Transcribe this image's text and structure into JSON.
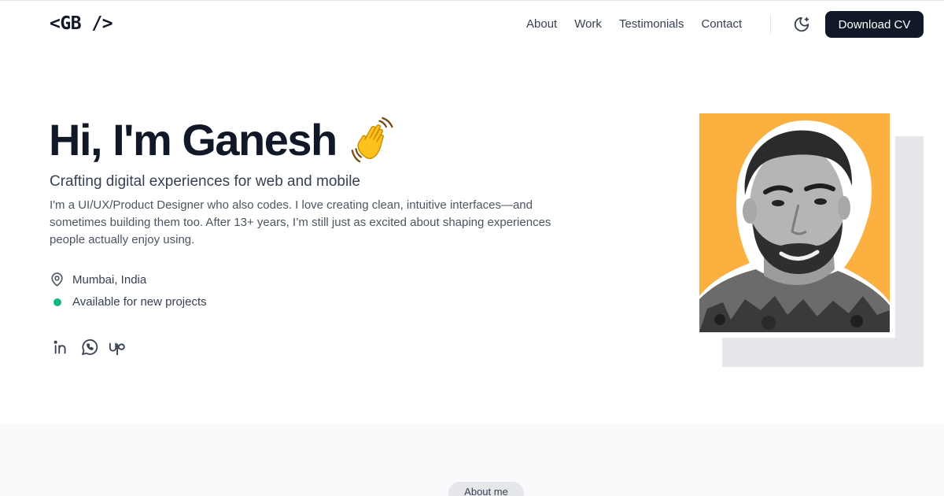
{
  "header": {
    "logo": "<GB />",
    "nav": [
      "About",
      "Work",
      "Testimonials",
      "Contact"
    ],
    "theme_icon": "moon-icon",
    "cv_label": "Download CV"
  },
  "hero": {
    "title": "Hi, I'm Ganesh",
    "wave_icon": "waving-hand-icon",
    "subtitle": "Crafting digital experiences for web and mobile",
    "description": "I'm a UI/UX/Product Designer who also codes. I love creating clean, intuitive interfaces—and sometimes building them too. After 13+ years, I’m still just as excited about shaping experiences people actually enjoy using.",
    "location": "Mumbai, India",
    "availability": "Available for new projects",
    "status_color": "#10b981",
    "socials": [
      "linkedin-icon",
      "whatsapp-icon",
      "upwork-icon"
    ]
  },
  "portrait": {
    "background_color": "#fbb040"
  },
  "about": {
    "pill_label": "About me"
  },
  "colors": {
    "primary": "#111827",
    "accent": "#fbb040"
  }
}
